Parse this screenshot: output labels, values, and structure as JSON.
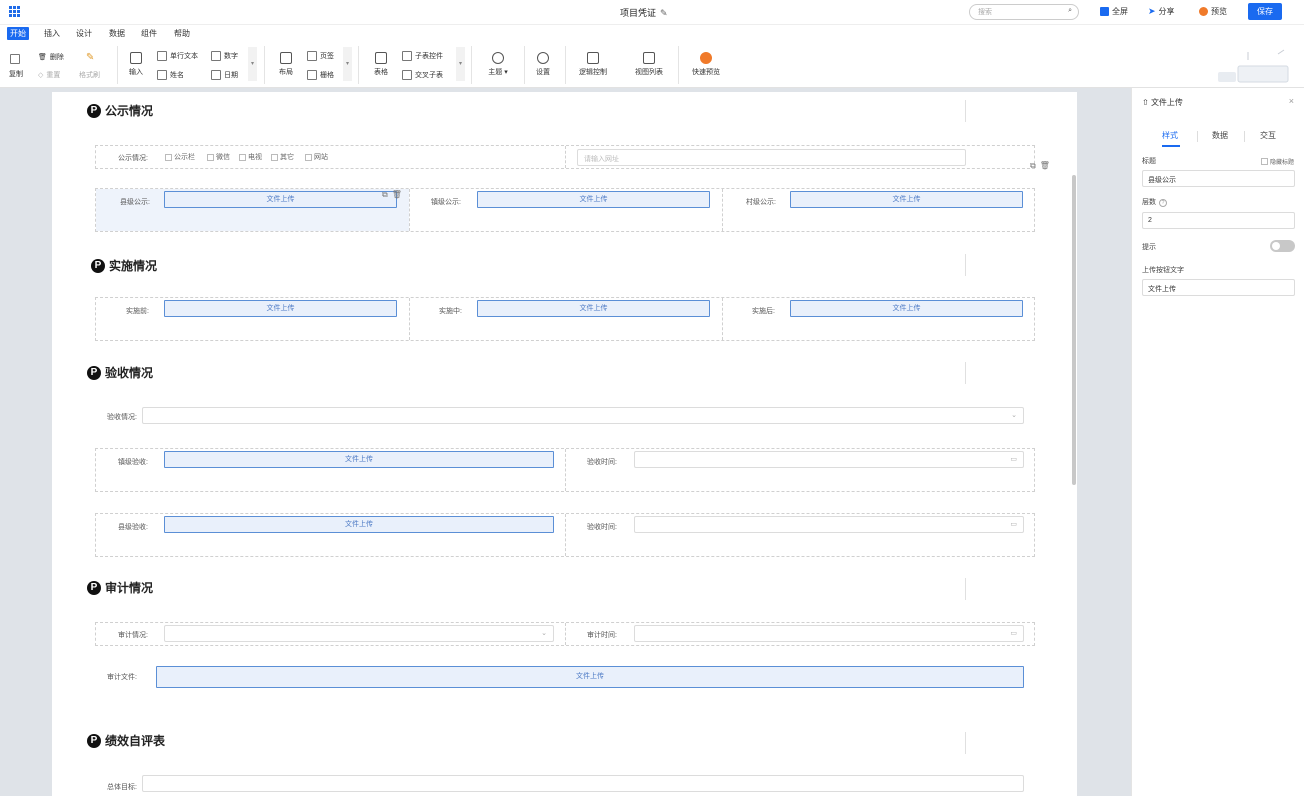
{
  "header": {
    "title": "项目凭证",
    "search_placeholder": "搜索",
    "fullscreen": "全屏",
    "share": "分享",
    "preview": "预览",
    "save": "保存"
  },
  "menu": [
    "开始",
    "插入",
    "设计",
    "数据",
    "组件",
    "帮助"
  ],
  "ribbon": {
    "copy": "复制",
    "delete": "删除",
    "reset": "重置",
    "format_painter": "格式刷",
    "input": "输入",
    "single_text": "单行文本",
    "number": "数字",
    "name": "姓名",
    "date": "日期",
    "layout": "布局",
    "tab_page": "页签",
    "grid": "栅格",
    "table": "表格",
    "subtable_ctrl": "子表控件",
    "cross_subtable": "交叉子表",
    "theme": "主题",
    "settings": "设置",
    "logic": "逻辑控制",
    "view_list": "视图列表",
    "quick_preview": "快速预览"
  },
  "sections": {
    "publicity": {
      "title": "公示情况",
      "label": "公示情况:",
      "options": [
        "公示栏",
        "微信",
        "电视",
        "其它",
        "网站"
      ],
      "url_placeholder": "请输入网址",
      "county": "县级公示:",
      "town": "镇级公示:",
      "village": "村级公示:"
    },
    "implementation": {
      "title": "实施情况",
      "before": "实施前:",
      "during": "实施中:",
      "after": "实施后:"
    },
    "acceptance": {
      "title": "验收情况",
      "label": "验收情况:",
      "town": "镇级验收:",
      "county": "县级验收:",
      "time": "验收时间:"
    },
    "audit": {
      "title": "审计情况",
      "label": "审计情况:",
      "time": "审计时间:",
      "file": "审计文件:"
    },
    "performance": {
      "title": "绩效自评表",
      "goal": "总体目标:"
    }
  },
  "upload_text": "文件上传",
  "panel": {
    "header": "文件上传",
    "tabs": [
      "样式",
      "数据",
      "交互"
    ],
    "title_label": "标题",
    "hide_title": "隐藏标题",
    "title_value": "县级公示",
    "level_label": "层数",
    "level_value": "2",
    "hint_label": "提示",
    "button_text_label": "上传按钮文字",
    "button_text_value": "文件上传"
  },
  "colors": {
    "accent": "#1a6af0",
    "upload_border": "#5b8fd6"
  }
}
